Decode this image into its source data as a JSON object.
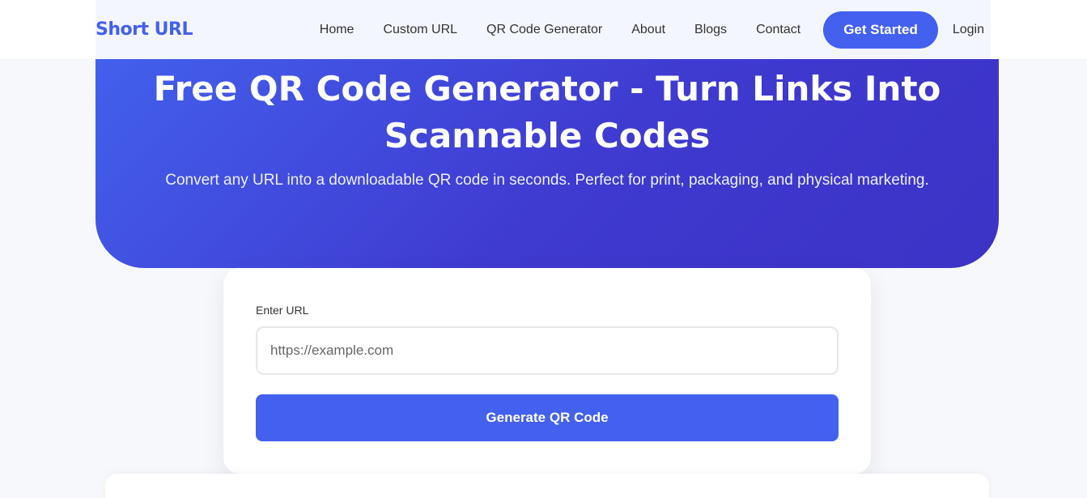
{
  "navbar": {
    "brand": "Short URL",
    "links": [
      {
        "label": "Home"
      },
      {
        "label": "Custom URL"
      },
      {
        "label": "QR Code Generator"
      },
      {
        "label": "About"
      },
      {
        "label": "Blogs"
      },
      {
        "label": "Contact"
      }
    ],
    "cta_label": "Get Started",
    "login_label": "Login"
  },
  "hero": {
    "title": "Free QR Code Generator - Turn Links Into Scannable Codes",
    "subtitle": "Convert any URL into a downloadable QR code in seconds. Perfect for print, packaging, and physical marketing."
  },
  "form": {
    "label": "Enter URL",
    "placeholder": "https://example.com",
    "value": "",
    "submit_label": "Generate QR Code"
  },
  "colors": {
    "accent": "#4361ee",
    "hero_gradient_end": "#3c32c6",
    "background": "#f7f8fb"
  }
}
